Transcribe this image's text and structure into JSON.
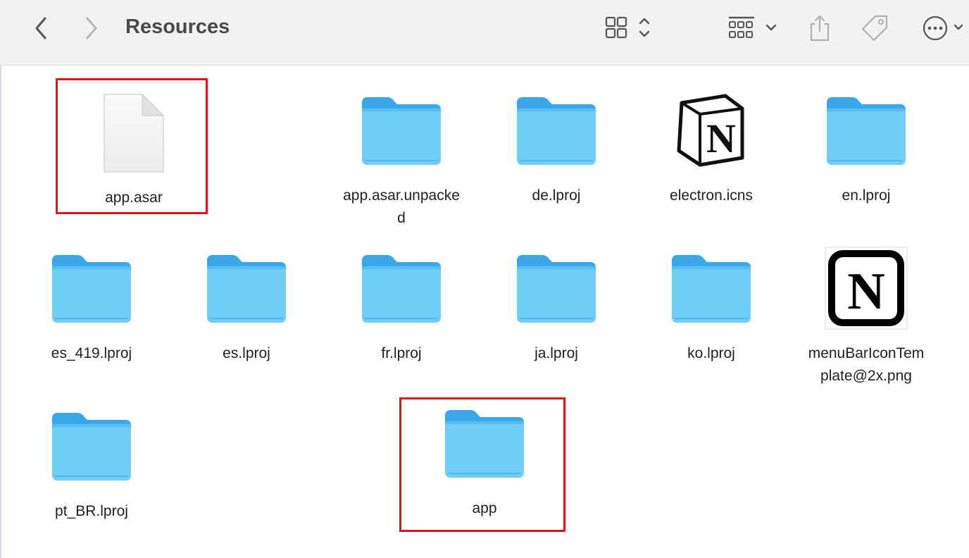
{
  "window": {
    "title": "Resources"
  },
  "toolbar": {
    "back_icon": "chevron-left-icon",
    "forward_icon": "chevron-right-icon",
    "view_icon": "grid-view-icon",
    "group_icon": "group-by-icon",
    "share_icon": "share-icon",
    "tag_icon": "tag-icon",
    "more_icon": "more-icon"
  },
  "items": [
    {
      "name": "app.asar",
      "kind": "file",
      "highlighted": true
    },
    {
      "name": "app.asar.unpacked",
      "line1": "app.asar.unpacke",
      "line2": "d",
      "kind": "folder"
    },
    {
      "name": "de.lproj",
      "kind": "folder"
    },
    {
      "name": "electron.icns",
      "kind": "notion-icon"
    },
    {
      "name": "en.lproj",
      "kind": "folder"
    },
    {
      "name": "es_419.lproj",
      "kind": "folder"
    },
    {
      "name": "es.lproj",
      "kind": "folder"
    },
    {
      "name": "fr.lproj",
      "kind": "folder"
    },
    {
      "name": "ja.lproj",
      "kind": "folder"
    },
    {
      "name": "ko.lproj",
      "kind": "folder"
    },
    {
      "name": "menuBarIconTemplate@2x.png",
      "line1": "menuBarIconTem",
      "line2": "plate@2x.png",
      "kind": "notion-png"
    },
    {
      "name": "pt_BR.lproj",
      "kind": "folder"
    },
    {
      "name": "app",
      "kind": "folder",
      "highlighted": true
    }
  ],
  "colors": {
    "folder": "#5ec3f5",
    "folder_tab": "#3aa7e8",
    "highlight": "#e3121b"
  }
}
